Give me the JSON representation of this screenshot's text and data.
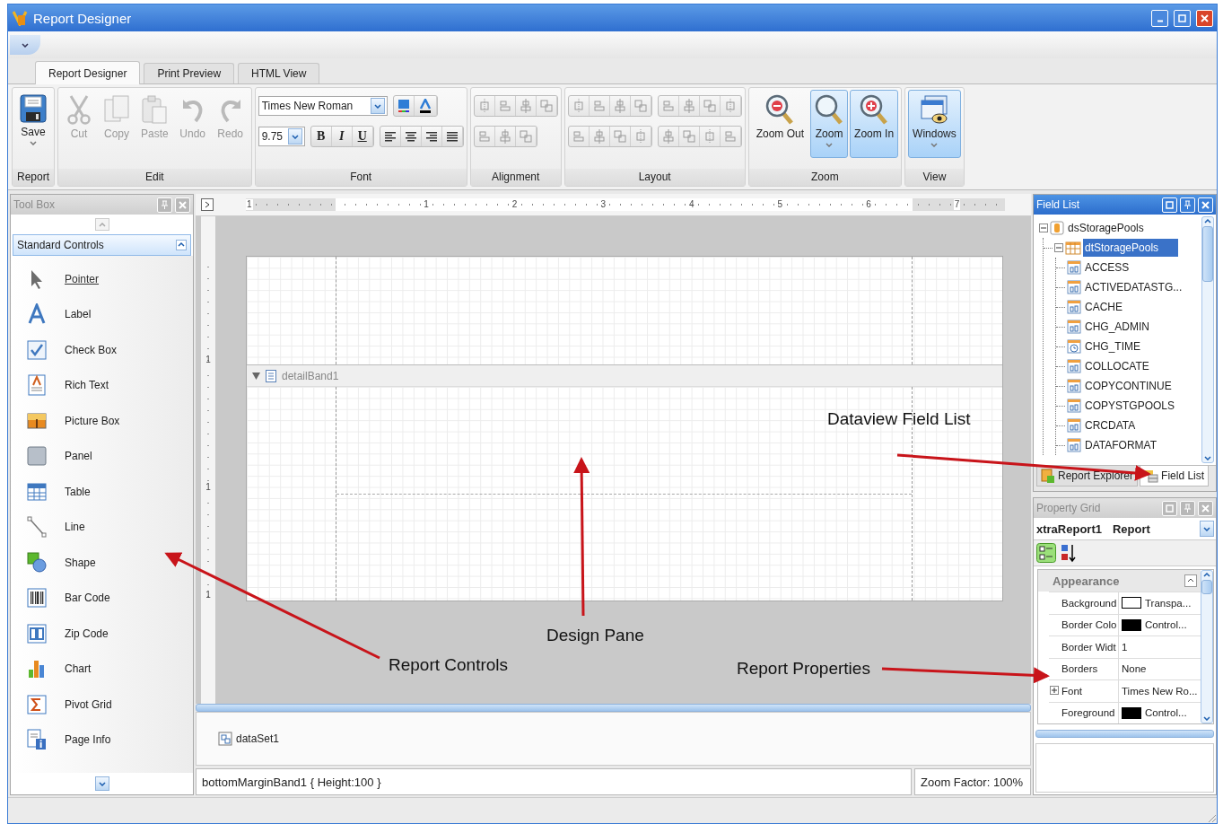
{
  "window": {
    "title": "Report Designer"
  },
  "tabs": [
    {
      "label": "Report Designer",
      "selected": true
    },
    {
      "label": "Print Preview",
      "selected": false
    },
    {
      "label": "HTML View",
      "selected": false
    }
  ],
  "ribbon": {
    "groups": [
      {
        "label": "Report",
        "kind": "large",
        "buttons": [
          {
            "label": "Save",
            "dropdown": true,
            "disabled": false,
            "selected": false
          }
        ]
      },
      {
        "label": "Edit",
        "kind": "large",
        "buttons": [
          {
            "label": "Cut",
            "dropdown": false,
            "disabled": true,
            "selected": false
          },
          {
            "label": "Copy",
            "dropdown": false,
            "disabled": true,
            "selected": false
          },
          {
            "label": "Paste",
            "dropdown": false,
            "disabled": true,
            "selected": false
          },
          {
            "label": "Undo",
            "dropdown": false,
            "disabled": true,
            "selected": false
          },
          {
            "label": "Redo",
            "dropdown": false,
            "disabled": true,
            "selected": false
          }
        ]
      },
      {
        "label": "Font",
        "kind": "font",
        "font_name": "Times New Roman",
        "font_size": "9.75",
        "format_buttons": [
          "B",
          "I",
          "U"
        ]
      },
      {
        "label": "Alignment",
        "kind": "icons",
        "disabled": true
      },
      {
        "label": "Layout",
        "kind": "icons",
        "disabled": true
      },
      {
        "label": "Zoom",
        "kind": "large",
        "buttons": [
          {
            "label": "Zoom Out",
            "dropdown": false,
            "disabled": false,
            "selected": false
          },
          {
            "label": "Zoom",
            "dropdown": true,
            "disabled": false,
            "selected": true
          },
          {
            "label": "Zoom In",
            "dropdown": false,
            "disabled": false,
            "selected": true
          }
        ]
      },
      {
        "label": "View",
        "kind": "large",
        "buttons": [
          {
            "label": "Windows",
            "dropdown": true,
            "disabled": false,
            "selected": true
          }
        ]
      }
    ]
  },
  "toolbox": {
    "title": "Tool Box",
    "active": false,
    "category": "Standard Controls",
    "items": [
      {
        "label": "Pointer",
        "selected": true
      },
      {
        "label": "Label",
        "selected": false
      },
      {
        "label": "Check Box",
        "selected": false
      },
      {
        "label": "Rich Text",
        "selected": false
      },
      {
        "label": "Picture Box",
        "selected": false
      },
      {
        "label": "Panel",
        "selected": false
      },
      {
        "label": "Table",
        "selected": false
      },
      {
        "label": "Line",
        "selected": false
      },
      {
        "label": "Shape",
        "selected": false
      },
      {
        "label": "Bar Code",
        "selected": false
      },
      {
        "label": "Zip Code",
        "selected": false
      },
      {
        "label": "Chart",
        "selected": false
      },
      {
        "label": "Pivot Grid",
        "selected": false
      },
      {
        "label": "Page Info",
        "selected": false
      }
    ]
  },
  "designer": {
    "ruler_labels": [
      "1",
      "1",
      "2",
      "3",
      "4",
      "5",
      "6",
      "7"
    ],
    "vertical_ruler_labels": [
      "1",
      "1",
      "1"
    ],
    "band": "detailBand1",
    "component": "dataSet1",
    "status": "bottomMarginBand1 { Height:100 }",
    "zoom_factor": "Zoom Factor: 100%"
  },
  "field_list": {
    "title": "Field List",
    "active": true,
    "tree": [
      {
        "label": "dsStoragePools",
        "kind": "dataset",
        "expanded": true,
        "selected": false,
        "children": [
          {
            "label": "dtStoragePools",
            "kind": "table",
            "expanded": true,
            "selected": true,
            "children": [
              {
                "label": "ACCESS",
                "kind": "text",
                "selected": false
              },
              {
                "label": "ACTIVEDATASTG...",
                "kind": "text",
                "selected": false
              },
              {
                "label": "CACHE",
                "kind": "text",
                "selected": false
              },
              {
                "label": "CHG_ADMIN",
                "kind": "text",
                "selected": false
              },
              {
                "label": "CHG_TIME",
                "kind": "date",
                "selected": false
              },
              {
                "label": "COLLOCATE",
                "kind": "text",
                "selected": false
              },
              {
                "label": "COPYCONTINUE",
                "kind": "text",
                "selected": false
              },
              {
                "label": "COPYSTGPOOLS",
                "kind": "text",
                "selected": false
              },
              {
                "label": "CRCDATA",
                "kind": "text",
                "selected": false
              },
              {
                "label": "DATAFORMAT",
                "kind": "text",
                "selected": false
              }
            ]
          }
        ]
      }
    ],
    "tabs": [
      {
        "label": "Report Explorer",
        "selected": false
      },
      {
        "label": "Field List",
        "selected": true
      }
    ]
  },
  "property_grid": {
    "title": "Property Grid",
    "active": false,
    "object": "xtraReport1",
    "object_type": "Report",
    "category": "Appearance",
    "rows": [
      {
        "name": "Background",
        "value": "Transpa...",
        "color": "#ffffff",
        "expandable": false
      },
      {
        "name": "Border Colo",
        "value": "Control...",
        "color": "#000000",
        "expandable": false
      },
      {
        "name": "Border Widt",
        "value": "1",
        "expandable": false
      },
      {
        "name": "Borders",
        "value": "None",
        "expandable": false
      },
      {
        "name": "Font",
        "value": "Times New Ro...",
        "expandable": true
      },
      {
        "name": "Foreground",
        "value": "Control...",
        "color": "#000000",
        "expandable": false
      }
    ]
  },
  "annotations": [
    {
      "text": "Dataview Field List"
    },
    {
      "text": "Design Pane"
    },
    {
      "text": "Report Controls"
    },
    {
      "text": "Report Properties"
    }
  ]
}
